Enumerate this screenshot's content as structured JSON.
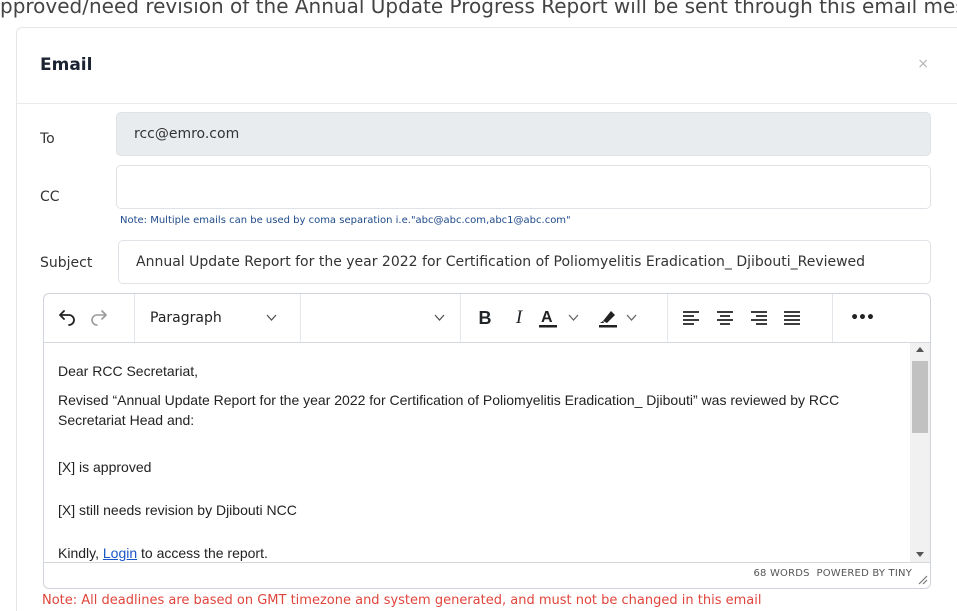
{
  "background": {
    "text": "pproved/need revision of the Annual Update Progress Report will be sent through this email message."
  },
  "modal": {
    "title": "Email",
    "close": "×"
  },
  "form": {
    "to_label": "To",
    "to_value": "rcc@emro.com",
    "cc_label": "CC",
    "cc_value": "",
    "cc_note": "Note: Multiple emails can be used by coma separation i.e.\"abc@abc.com,abc1@abc.com\"",
    "subject_label": "Subject",
    "subject_value": "Annual Update Report for the year 2022 for Certification of Poliomyelitis Eradication_ Djibouti_Reviewed"
  },
  "toolbar": {
    "undo_icon": "undo-icon",
    "redo_icon": "redo-icon",
    "block_format": "Paragraph",
    "font_size": "",
    "bold": "B",
    "italic": "I",
    "text_color": "A",
    "more": "•••"
  },
  "body": {
    "greeting": "Dear RCC Secretariat,",
    "p1": "Revised “Annual Update Report for the year 2022 for Certification of Poliomyelitis Eradication_ Djibouti” was reviewed by RCC Secretariat Head and:",
    "p2": "[X] is approved",
    "p3": "[X] still needs revision by Djibouti NCC",
    "p4_before": "Kindly, ",
    "p4_link": "Login",
    "p4_after": " to access the report."
  },
  "status": {
    "words": "68 WORDS",
    "powered": "POWERED BY TINY"
  },
  "footer_note": "Note: All deadlines are based on GMT timezone and system generated, and must not be changed in this email",
  "colors": {
    "accent_link": "#1a57c6",
    "note_red": "#e0453c",
    "note_blue": "#1e4a8a",
    "readonly_bg": "#e9ecef"
  }
}
